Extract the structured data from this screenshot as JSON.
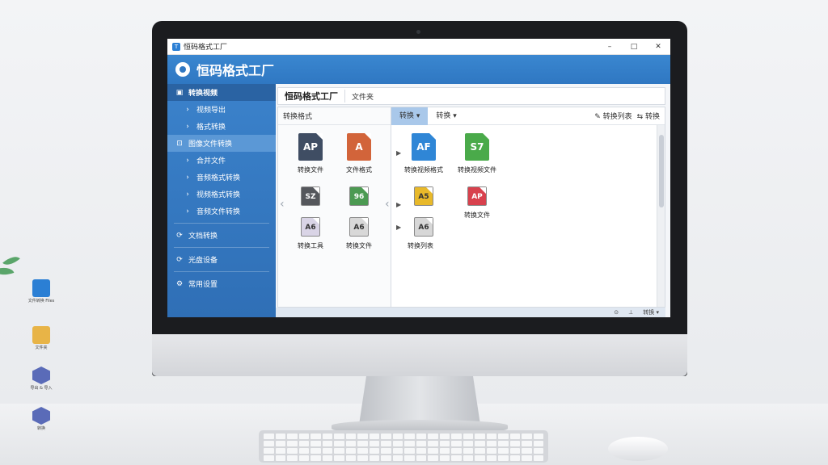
{
  "window": {
    "title": "恒码格式工厂",
    "controls": [
      "–",
      "□",
      "✕"
    ]
  },
  "app": {
    "name": "恒码格式工厂"
  },
  "sidebar": {
    "items": [
      {
        "label": "转换视频",
        "icon": "▣",
        "kind": "head"
      },
      {
        "label": "视频导出",
        "icon": "›",
        "kind": "sub"
      },
      {
        "label": "格式转换",
        "icon": "›",
        "kind": "sub"
      },
      {
        "label": "图像文件转换",
        "icon": "⊡",
        "kind": "hl"
      },
      {
        "label": "合并文件",
        "icon": "›",
        "kind": "sub"
      },
      {
        "label": "音频格式转换",
        "icon": "›",
        "kind": "sub"
      },
      {
        "label": "视频格式转换",
        "icon": "›",
        "kind": "sub"
      },
      {
        "label": "音频文件转换",
        "icon": "›",
        "kind": "sub"
      },
      {
        "label": "文档转换",
        "icon": "⟳",
        "kind": "item"
      },
      {
        "label": "光盘设备",
        "icon": "⟳",
        "kind": "item"
      },
      {
        "label": "常用设置",
        "icon": "⚙",
        "kind": "item"
      }
    ]
  },
  "content": {
    "title": "恒码格式工厂",
    "tab2": "文件夹",
    "left_pane": {
      "header": "转换格式",
      "icons": [
        {
          "glyph": "AP",
          "label": "转换文件",
          "color": "#3f4d63"
        },
        {
          "glyph": "A",
          "label": "文件格式",
          "color": "#d2643a"
        },
        {
          "glyph": "SZ",
          "label": "",
          "color": "#55575c"
        },
        {
          "glyph": "96",
          "label": "",
          "color": "#4c9a52"
        },
        {
          "glyph": "A6",
          "label": "转换工具",
          "color": "#d9d4e6"
        },
        {
          "glyph": "A6",
          "label": "转换文件",
          "color": "#d8d8d8"
        }
      ]
    },
    "right_pane": {
      "tabs": [
        "转换 ▾",
        "转换 ▾"
      ],
      "actions": [
        "✎ 转换列表",
        "⇆ 转换"
      ],
      "items": [
        {
          "glyph": "AF",
          "label": "转换视频格式",
          "color": "#2f86d6"
        },
        {
          "glyph": "S7",
          "label": "转换视频文件",
          "color": "#4aaa4a"
        },
        {
          "glyph": "A5",
          "label": "",
          "color": "#e8b92a"
        },
        {
          "glyph": "AP",
          "label": "转换文件",
          "color": "#d8414d"
        },
        {
          "glyph": "A6",
          "label": "转换列表",
          "color": "#d7d7d7"
        }
      ]
    },
    "status": [
      "⊙",
      "⊥",
      "转换 ▾"
    ]
  },
  "desktop_icons": [
    {
      "label": "文件转换 Files",
      "color": "#2b7fd4"
    },
    {
      "label": "文件夹",
      "color": "#e8b447"
    },
    {
      "label": "导出 & 导入",
      "color": "#5a6bb8"
    },
    {
      "label": "转换",
      "color": "#5a6bb8"
    }
  ]
}
